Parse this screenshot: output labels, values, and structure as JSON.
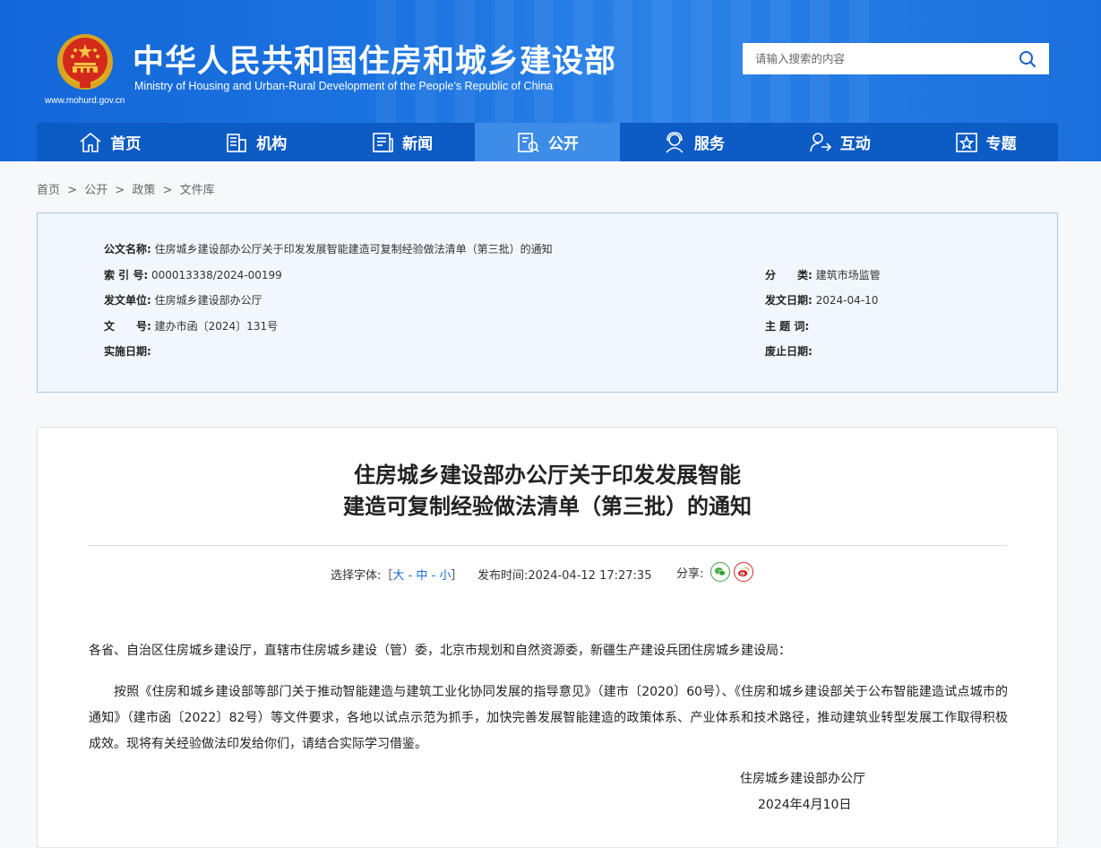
{
  "header": {
    "title": "中华人民共和国住房和城乡建设部",
    "subtitle": "Ministry of Housing and Urban-Rural Development of the People's Republic of China",
    "url": "www.mohurd.gov.cn",
    "search_placeholder": "请输入搜索的内容"
  },
  "nav": {
    "items": [
      {
        "label": "首页",
        "icon": "home-icon"
      },
      {
        "label": "机构",
        "icon": "building-icon"
      },
      {
        "label": "新闻",
        "icon": "news-icon"
      },
      {
        "label": "公开",
        "icon": "open-icon"
      },
      {
        "label": "服务",
        "icon": "service-icon"
      },
      {
        "label": "互动",
        "icon": "interact-icon"
      },
      {
        "label": "专题",
        "icon": "topic-icon"
      }
    ],
    "active": "公开"
  },
  "breadcrumb": {
    "items": [
      "首页",
      "公开",
      "政策",
      "文件库"
    ],
    "separator": ">"
  },
  "info": {
    "doc_name_label": "公文名称:",
    "doc_name": "住房城乡建设部办公厅关于印发发展智能建造可复制经验做法清单（第三批）的通知",
    "index_label": "索 引 号:",
    "index": "000013338/2024-00199",
    "category_label": "分　　类:",
    "category": "建筑市场监管",
    "issuer_label": "发文单位:",
    "issuer": "住房城乡建设部办公厅",
    "issue_date_label": "发文日期:",
    "issue_date": "2024-04-10",
    "doc_no_label": "文　　号:",
    "doc_no": "建办市函〔2024〕131号",
    "keywords_label": "主 题 词:",
    "keywords": "",
    "effective_label": "实施日期:",
    "effective": "",
    "expiry_label": "废止日期:",
    "expiry": ""
  },
  "article": {
    "title_line1": "住房城乡建设部办公厅关于印发发展智能",
    "title_line2": "建造可复制经验做法清单（第三批）的通知",
    "font_label": "选择字体:",
    "font_open": "［",
    "font_large": "大",
    "font_medium": "中",
    "font_small": "小",
    "font_dash": "-",
    "font_close": "］",
    "pub_label": "发布时间:",
    "pub_time": "2024-04-12 17:27:35",
    "share_label": "分享:",
    "salutation": "各省、自治区住房城乡建设厅，直辖市住房城乡建设（管）委，北京市规划和自然资源委，新疆生产建设兵团住房城乡建设局：",
    "paragraph": "按照《住房和城乡建设部等部门关于推动智能建造与建筑工业化协同发展的指导意见》（建市〔2020〕60号）、《住房和城乡建设部关于公布智能建造试点城市的通知》（建市函〔2022〕82号）等文件要求，各地以试点示范为抓手，加快完善发展智能建造的政策体系、产业体系和技术路径，推动建筑业转型发展工作取得积极成效。现将有关经验做法印发给你们，请结合实际学习借鉴。",
    "signature": "住房城乡建设部办公厅",
    "date": "2024年4月10日"
  },
  "colors": {
    "header_blue": "#1b73e0",
    "nav_blue": "#0d5bc4",
    "nav_active": "#3d8ce8",
    "link_blue": "#1a6ad6",
    "wechat_green": "#3aa336",
    "weibo_red": "#d5242c"
  }
}
